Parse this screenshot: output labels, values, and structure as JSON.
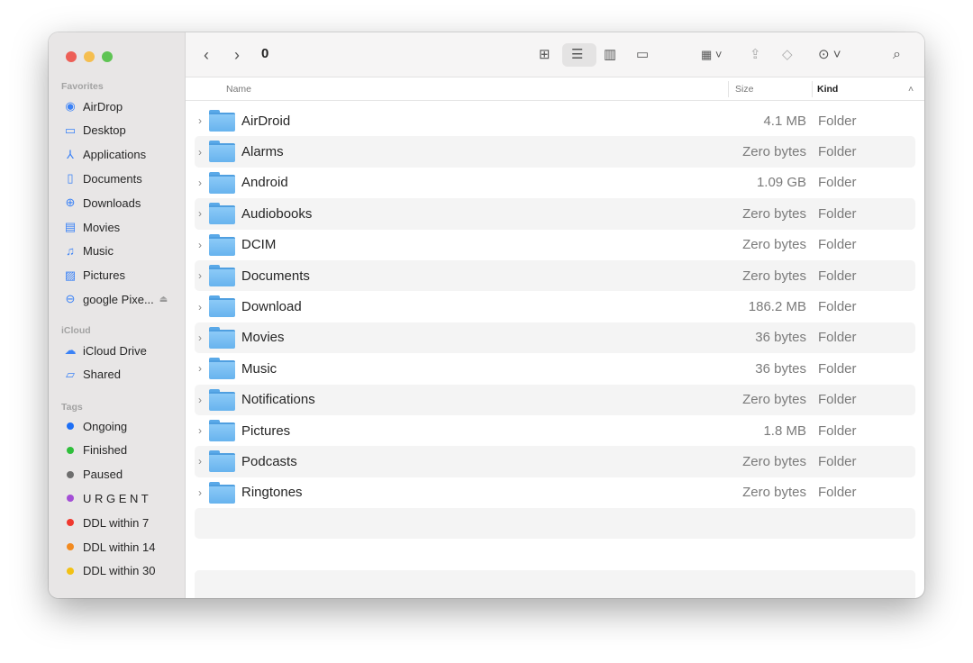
{
  "window": {
    "title": "0",
    "traffic_lights": [
      "#ed5f57",
      "#f5be4f",
      "#5fc454"
    ]
  },
  "sidebar": {
    "favorites_label": "Favorites",
    "favorites": [
      {
        "label": "AirDrop",
        "icon": "airdrop-icon",
        "glyph": "◉"
      },
      {
        "label": "Desktop",
        "icon": "desktop-icon",
        "glyph": "▭"
      },
      {
        "label": "Applications",
        "icon": "applications-icon",
        "glyph": "⅄"
      },
      {
        "label": "Documents",
        "icon": "document-icon",
        "glyph": "▯"
      },
      {
        "label": "Downloads",
        "icon": "download-icon",
        "glyph": "⊕"
      },
      {
        "label": "Movies",
        "icon": "film-icon",
        "glyph": "▤"
      },
      {
        "label": "Music",
        "icon": "music-icon",
        "glyph": "♫"
      },
      {
        "label": "Pictures",
        "icon": "photo-icon",
        "glyph": "▨"
      },
      {
        "label": "google Pixe...",
        "icon": "drive-icon",
        "glyph": "⊖"
      }
    ],
    "icloud_label": "iCloud",
    "icloud": [
      {
        "label": "iCloud Drive",
        "icon": "cloud-icon",
        "glyph": "☁"
      },
      {
        "label": "Shared",
        "icon": "shared-folder-icon",
        "glyph": "▱"
      }
    ],
    "tags_label": "Tags",
    "tags": [
      {
        "label": "Ongoing",
        "color": "#1e6ff5"
      },
      {
        "label": "Finished",
        "color": "#2fbf3b"
      },
      {
        "label": "Paused",
        "color": "#6e6e6e"
      },
      {
        "label": "U R G E N T",
        "color": "#a44fd6"
      },
      {
        "label": "DDL within 7",
        "color": "#f0382e"
      },
      {
        "label": "DDL within 14",
        "color": "#f28a1f"
      },
      {
        "label": "DDL within 30",
        "color": "#f2c114"
      }
    ]
  },
  "columns": {
    "name": "Name",
    "size": "Size",
    "kind": "Kind"
  },
  "files": [
    {
      "name": "AirDroid",
      "size": "4.1 MB",
      "kind": "Folder"
    },
    {
      "name": "Alarms",
      "size": "Zero bytes",
      "kind": "Folder"
    },
    {
      "name": "Android",
      "size": "1.09 GB",
      "kind": "Folder"
    },
    {
      "name": "Audiobooks",
      "size": "Zero bytes",
      "kind": "Folder"
    },
    {
      "name": "DCIM",
      "size": "Zero bytes",
      "kind": "Folder"
    },
    {
      "name": "Documents",
      "size": "Zero bytes",
      "kind": "Folder"
    },
    {
      "name": "Download",
      "size": "186.2 MB",
      "kind": "Folder"
    },
    {
      "name": "Movies",
      "size": "36 bytes",
      "kind": "Folder"
    },
    {
      "name": "Music",
      "size": "36 bytes",
      "kind": "Folder"
    },
    {
      "name": "Notifications",
      "size": "Zero bytes",
      "kind": "Folder"
    },
    {
      "name": "Pictures",
      "size": "1.8 MB",
      "kind": "Folder"
    },
    {
      "name": "Podcasts",
      "size": "Zero bytes",
      "kind": "Folder"
    },
    {
      "name": "Ringtones",
      "size": "Zero bytes",
      "kind": "Folder"
    }
  ]
}
